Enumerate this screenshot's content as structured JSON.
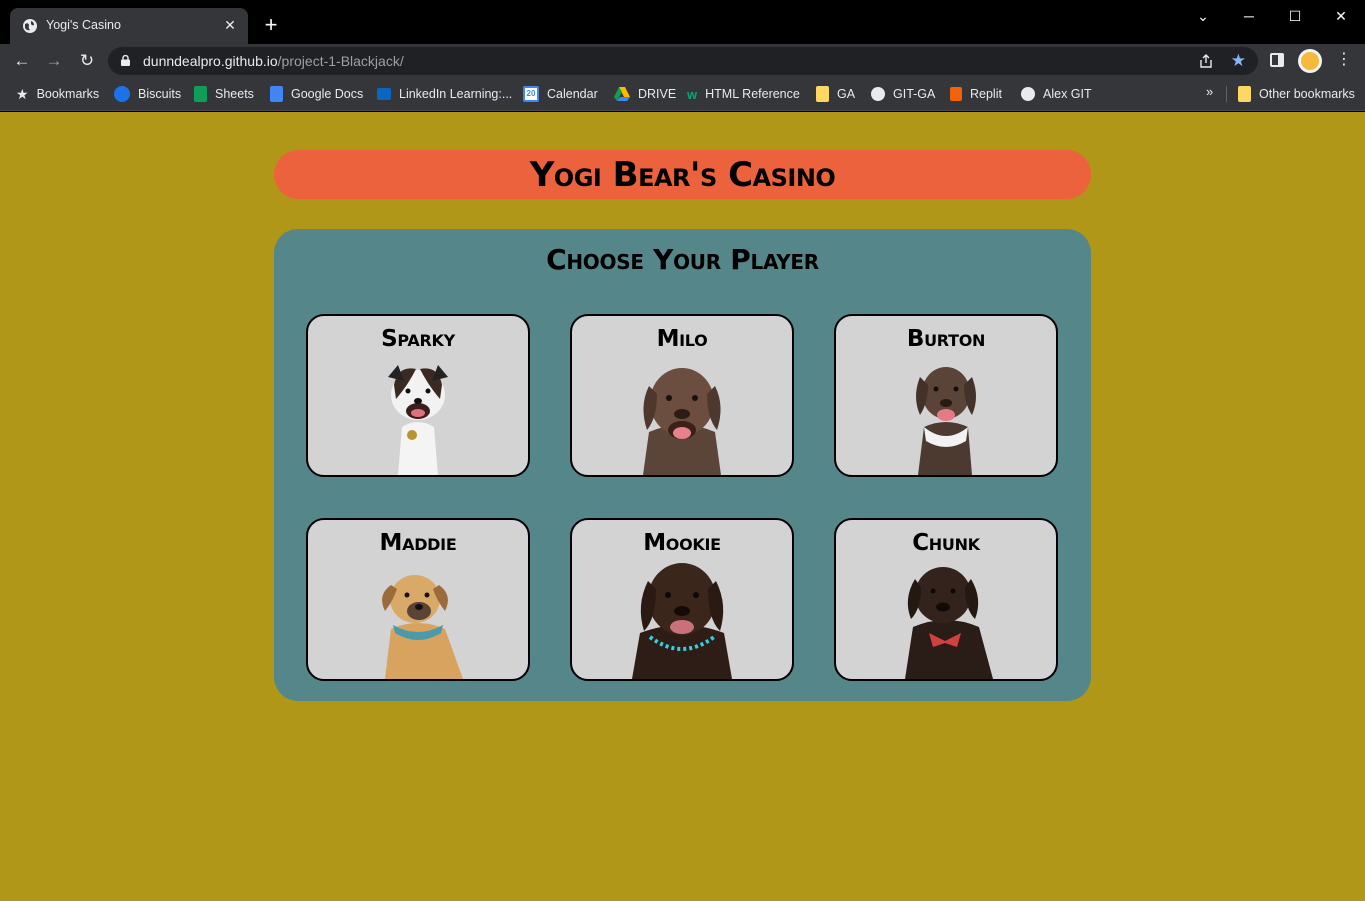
{
  "browser": {
    "tab_title": "Yogi's Casino",
    "url_host": "dunndealpro.github.io",
    "url_path": "/project-1-Blackjack/",
    "bookmarks": [
      {
        "label": "Bookmarks",
        "icon": "star-icon"
      },
      {
        "label": "Biscuits",
        "icon": "biscuits-icon"
      },
      {
        "label": "Sheets",
        "icon": "sheets-icon"
      },
      {
        "label": "Google Docs",
        "icon": "docs-icon"
      },
      {
        "label": "LinkedIn Learning:...",
        "icon": "linkedin-learning-icon"
      },
      {
        "label": "Calendar",
        "icon": "calendar-icon"
      },
      {
        "label": "DRIVE",
        "icon": "drive-icon"
      },
      {
        "label": "HTML Reference",
        "icon": "w3-icon"
      },
      {
        "label": "GA",
        "icon": "folder-icon"
      },
      {
        "label": "GIT-GA",
        "icon": "github-icon"
      },
      {
        "label": "Replit",
        "icon": "replit-icon"
      },
      {
        "label": "Alex GIT",
        "icon": "github-icon"
      }
    ],
    "other_bookmarks": "Other bookmarks",
    "calendar_day": "20"
  },
  "page": {
    "title": "Yogi Bear's Casino",
    "heading": "Choose Your Player",
    "players": [
      {
        "name": "Sparky"
      },
      {
        "name": "Milo"
      },
      {
        "name": "Burton"
      },
      {
        "name": "Maddie"
      },
      {
        "name": "Mookie"
      },
      {
        "name": "Chunk"
      }
    ]
  },
  "colors": {
    "background": "#b09718",
    "title_banner": "#ec623c",
    "panel": "#54868a",
    "card": "#d3d3d3"
  }
}
